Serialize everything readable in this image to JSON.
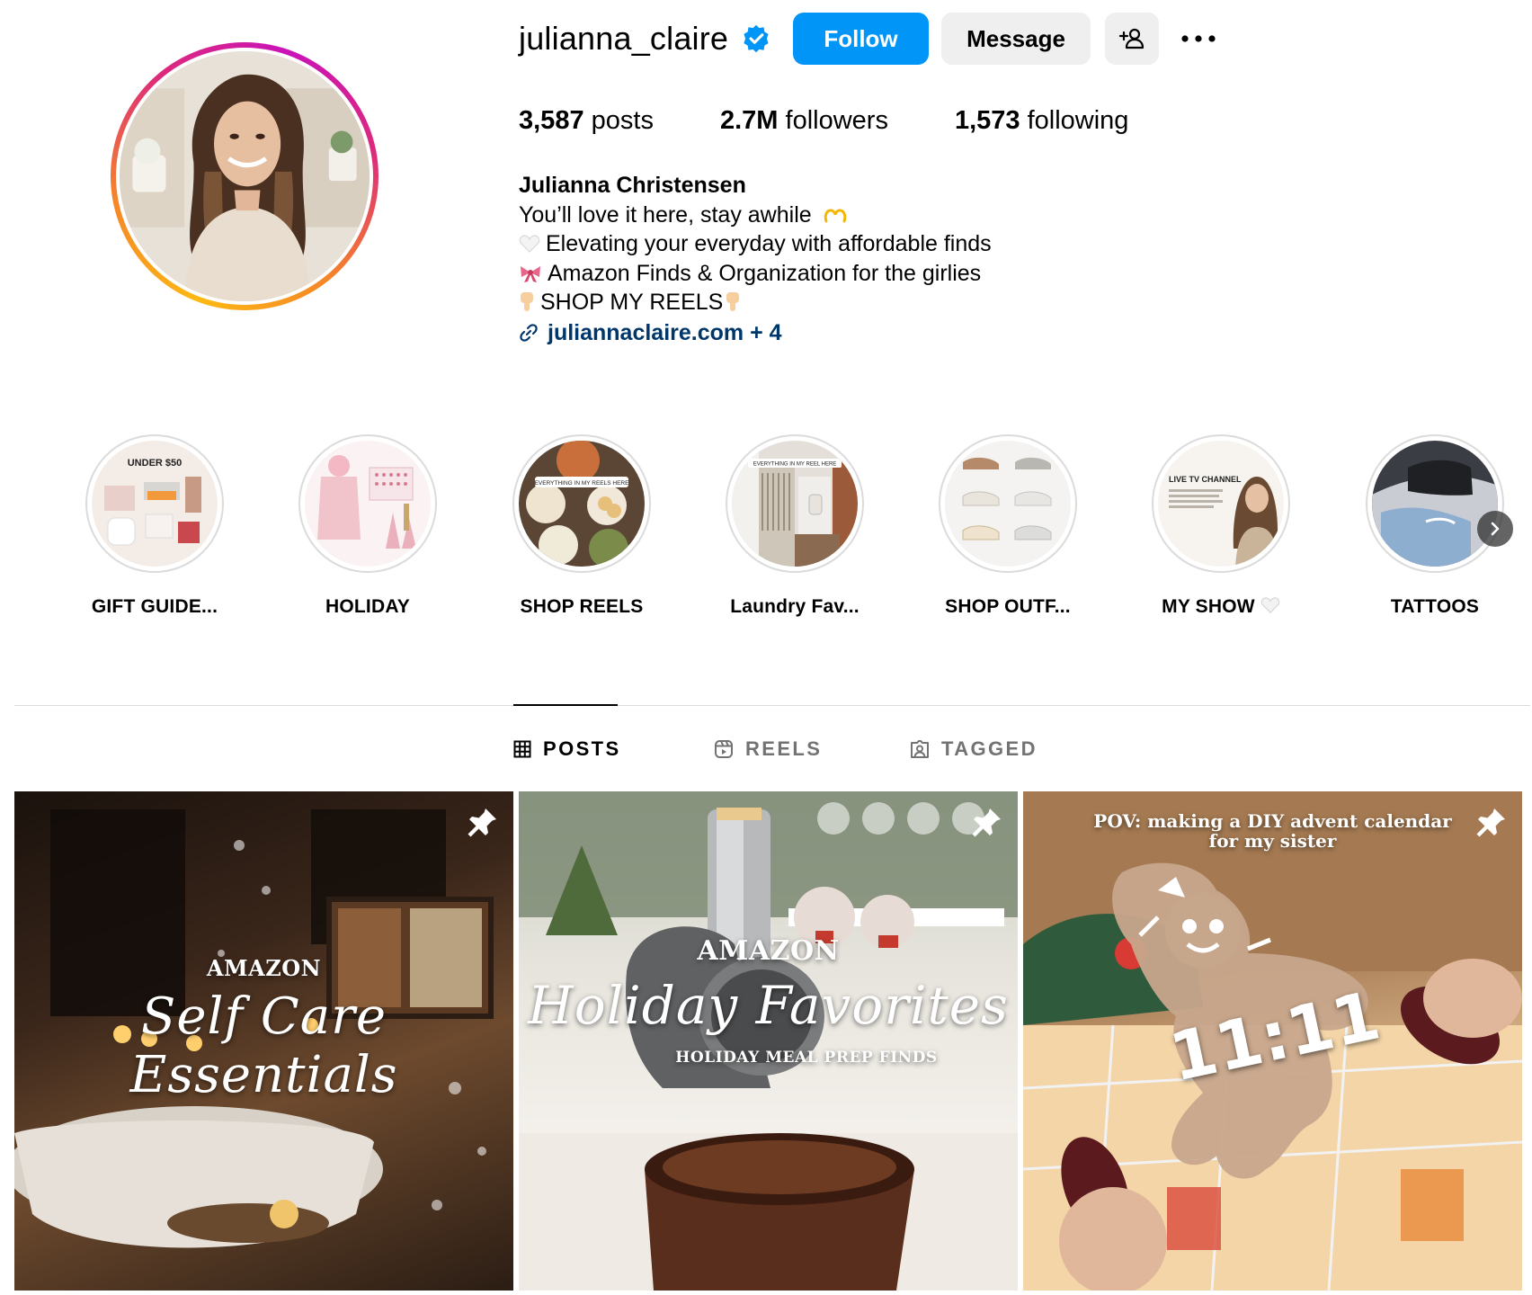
{
  "profile": {
    "username": "julianna_claire",
    "verified": true,
    "follow_label": "Follow",
    "message_label": "Message",
    "stats": {
      "posts_count": "3,587",
      "posts_label": "posts",
      "followers_count": "2.7M",
      "followers_label": "followers",
      "following_count": "1,573",
      "following_label": "following"
    },
    "bio": {
      "name": "Julianna Christensen",
      "line1": "You’ll love it here, stay awhile",
      "line2": "Elevating your everyday with affordable finds",
      "line3": "Amazon Finds & Organization for the girlies",
      "line4": "SHOP MY REELS",
      "link": "juliannaclaire.com + 4"
    }
  },
  "highlights": [
    {
      "label": "GIFT GUIDE...",
      "thumb_text": "UNDER $50"
    },
    {
      "label": "HOLIDAY"
    },
    {
      "label": "SHOP REELS",
      "thumb_text": "EVERYTHING IN MY REELS HERE"
    },
    {
      "label": "Laundry Fav...",
      "thumb_text": "EVERYTHING IN MY REEL HERE"
    },
    {
      "label": "SHOP OUTF..."
    },
    {
      "label": "MY SHOW",
      "thumb_text": "LIVE TV CHANNEL"
    },
    {
      "label": "TATTOOS"
    }
  ],
  "tabs": [
    {
      "label": "POSTS",
      "active": true
    },
    {
      "label": "REELS",
      "active": false
    },
    {
      "label": "TAGGED",
      "active": false
    }
  ],
  "posts": [
    {
      "top_text": "AMAZON",
      "script_text": "Self Care Essentials",
      "pinned": true
    },
    {
      "top_text": "AMAZON",
      "script_text": "Holiday Favorites",
      "sub_text": "HOLIDAY MEAL PREP FINDS",
      "pinned": true
    },
    {
      "caption_line1": "POV: making a DIY advent calendar",
      "caption_line2": "for my sister",
      "big_text": "11:11",
      "pinned": true
    }
  ],
  "colors": {
    "accent": "#0095f6",
    "link": "#00376b",
    "button_gray": "#efefef",
    "divider": "#dbdbdb",
    "muted": "#737373"
  },
  "icons": [
    "verified-badge-icon",
    "add-person-icon",
    "more-icon",
    "link-icon",
    "grid-icon",
    "reels-icon",
    "tagged-icon",
    "pin-icon",
    "chevron-right-icon"
  ]
}
